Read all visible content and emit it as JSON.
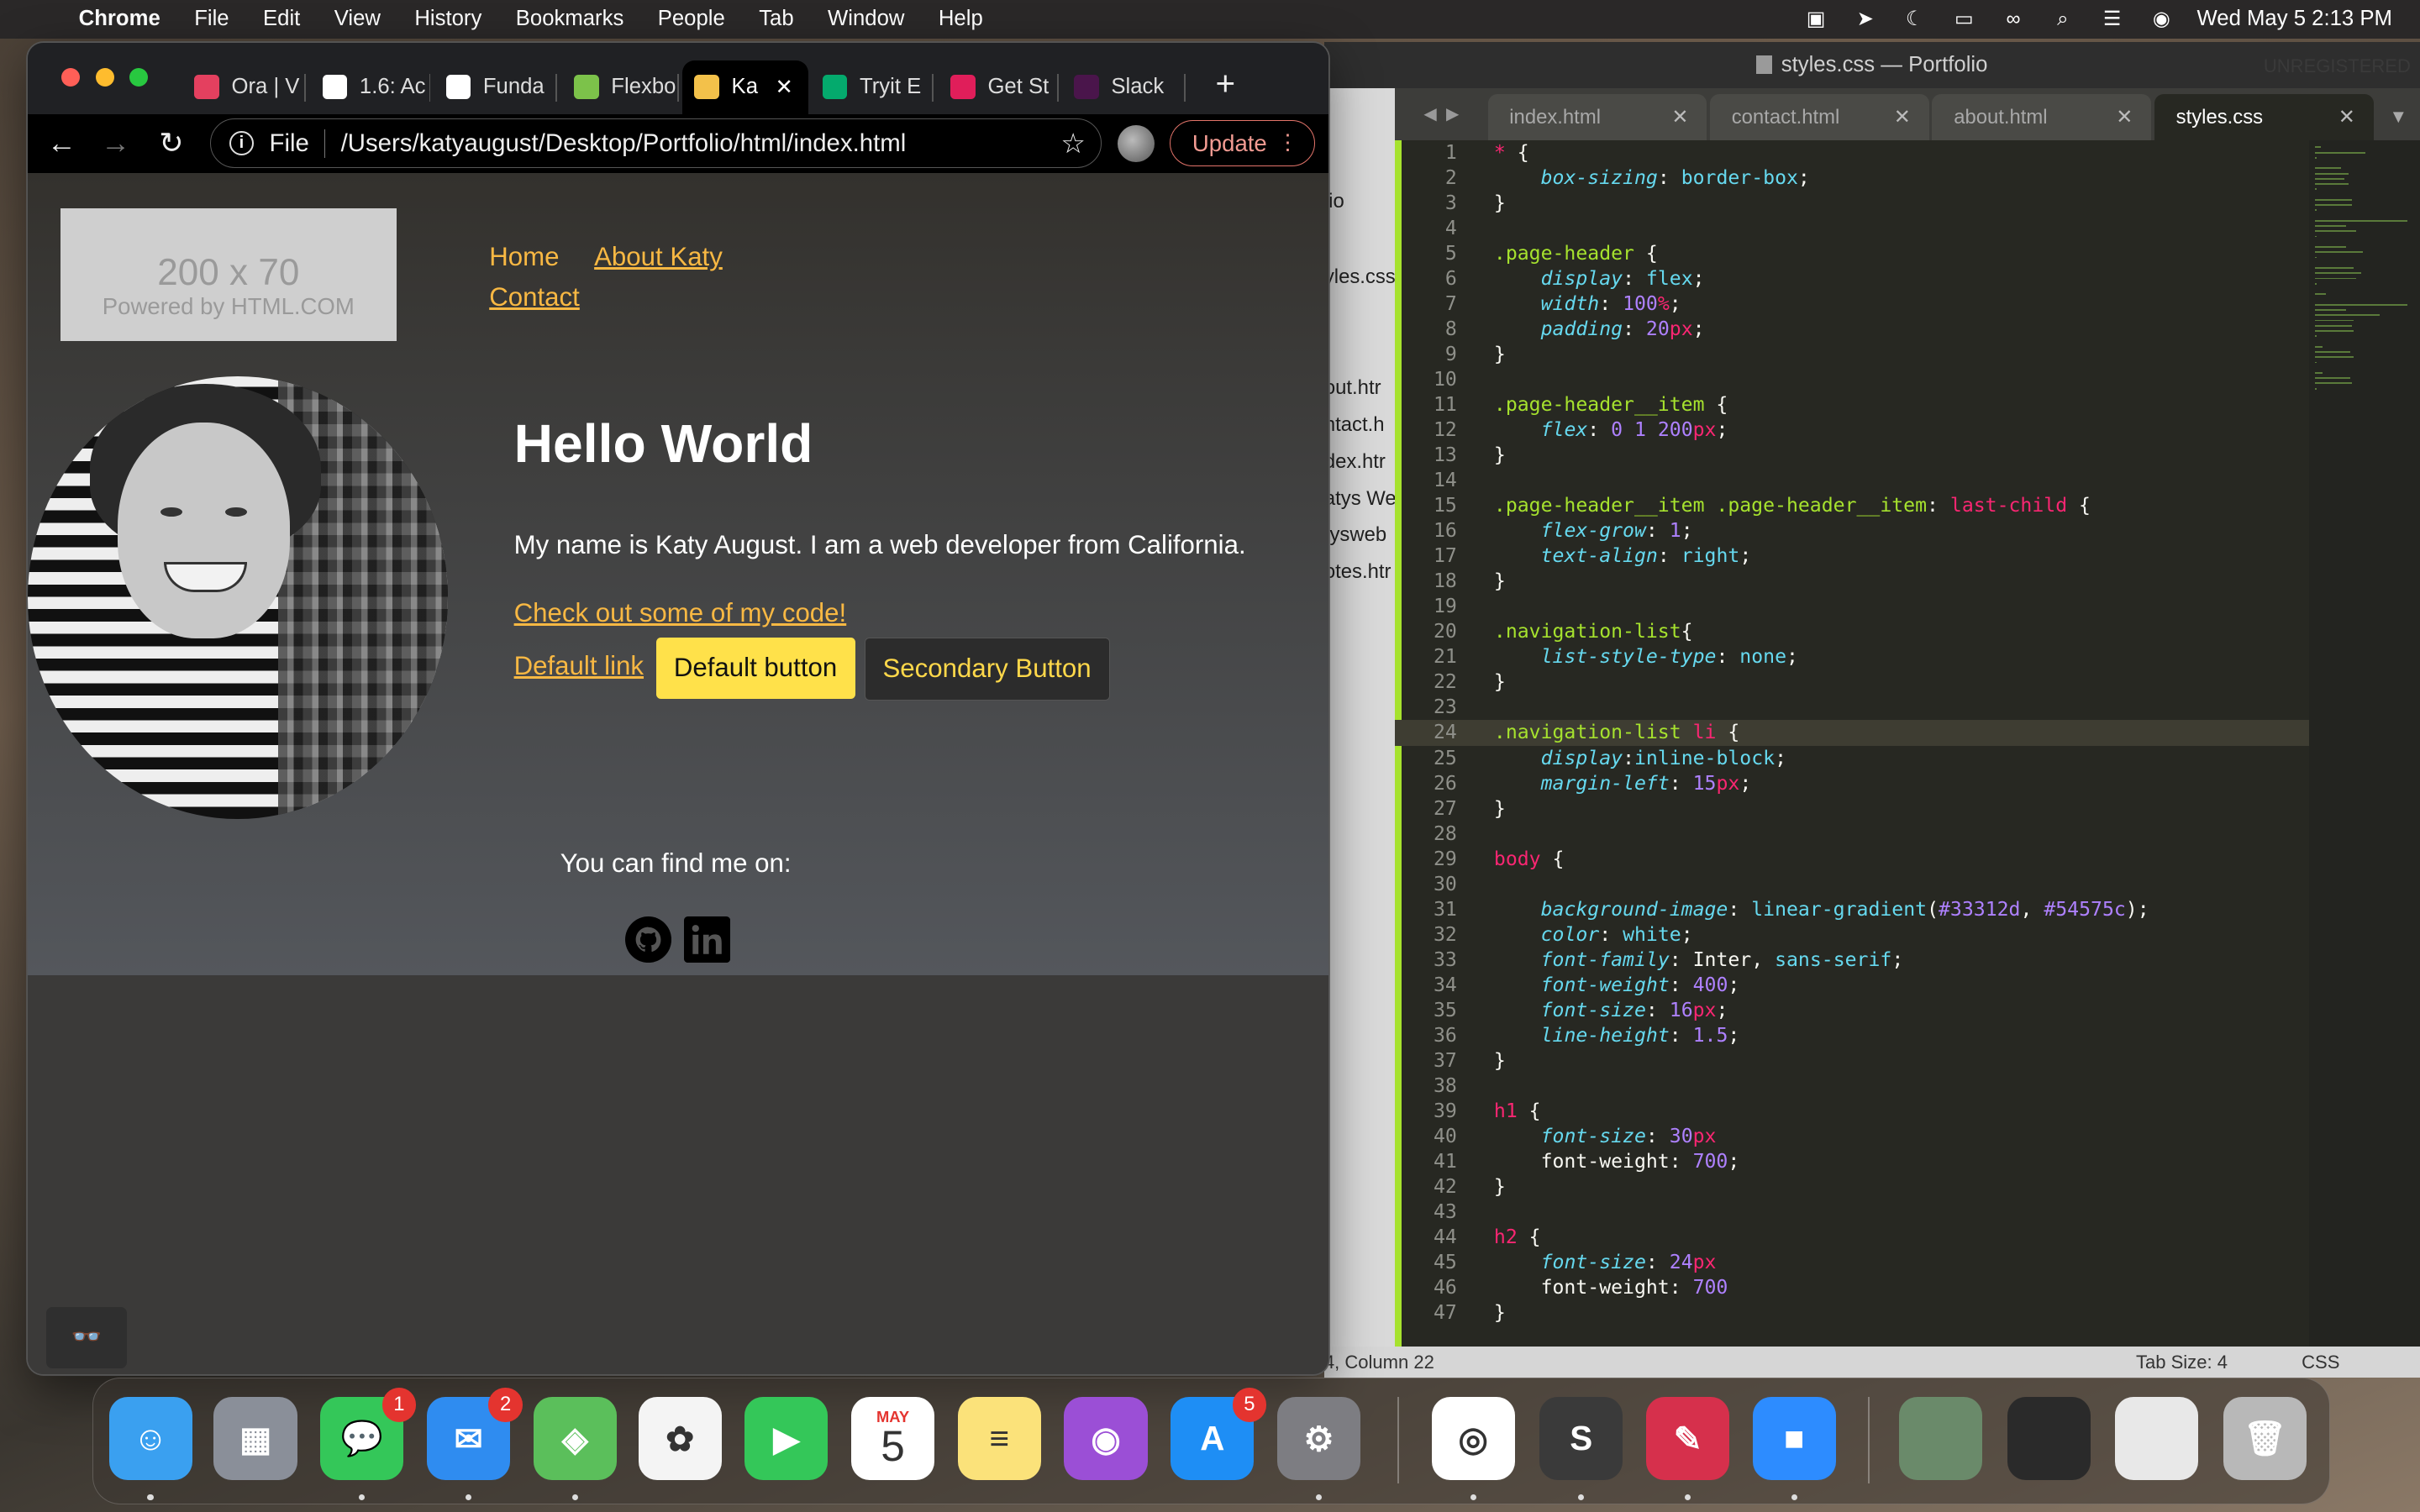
{
  "menubar": {
    "app_name": "Chrome",
    "items": [
      "File",
      "Edit",
      "View",
      "History",
      "Bookmarks",
      "People",
      "Tab",
      "Window",
      "Help"
    ],
    "status_icons": [
      "screen-record-icon",
      "share-arrow-icon",
      "do-not-disturb-moon-icon",
      "battery-icon",
      "link-icon",
      "spotlight-search-icon",
      "control-center-icon",
      "siri-icon"
    ],
    "clock": "Wed May 5  2:13 PM"
  },
  "chrome": {
    "tabs": [
      {
        "label": "Ora | V",
        "favicon": "ora-icon",
        "color": "#e4405f"
      },
      {
        "label": "1.6: Ac",
        "favicon": "of-icon",
        "color": "#ffffff"
      },
      {
        "label": "Funda",
        "favicon": "codepen-icon",
        "color": "#ffffff"
      },
      {
        "label": "Flexbo",
        "favicon": "frog-icon",
        "color": "#7cc24a"
      },
      {
        "label": "Ka",
        "favicon": "copy-icon",
        "color": "#f3c14a"
      },
      {
        "label": "Tryit E",
        "favicon": "w3schools-icon",
        "color": "#04aa6d"
      },
      {
        "label": "Get St",
        "favicon": "slack-icon",
        "color": "#e01e5a"
      },
      {
        "label": "Slack",
        "favicon": "slack-icon",
        "color": "#4a154b"
      }
    ],
    "active_tab_index": 4,
    "omnibox": {
      "scheme": "File",
      "url": "/Users/katyaugust/Desktop/Portfolio/html/index.html"
    },
    "update_label": "Update",
    "page": {
      "placeholder_big": "200 x 70",
      "placeholder_small": "Powered by HTML.COM",
      "nav": [
        "Home",
        "About Katy",
        "Contact"
      ],
      "heading": "Hello World",
      "intro": "My name is Katy August. I am a web developer from California.",
      "code_link": "Check out some of my code!",
      "default_link": "Default link",
      "default_button": "Default button",
      "secondary_button": "Secondary Button",
      "find_me": "You can find me on:",
      "social_icons": [
        "github-icon",
        "linkedin-icon"
      ]
    }
  },
  "sublime": {
    "title": "styles.css — Portfolio",
    "unregistered": "UNREGISTERED",
    "sidebar_items": [
      "lio",
      "yles.css",
      "out.htr",
      "ntact.h",
      "dex.htr",
      "atys We",
      "tysweb",
      "otes.htr"
    ],
    "tabs": [
      {
        "label": "index.html",
        "active": false
      },
      {
        "label": "contact.html",
        "active": false
      },
      {
        "label": "about.html",
        "active": false
      },
      {
        "label": "styles.css",
        "active": true
      }
    ],
    "current_line": 24,
    "status_position": "4, Column 22",
    "status_tab_size": "Tab Size: 4",
    "status_syntax": "CSS",
    "code_lines": [
      [
        [
          "t-tag",
          "*"
        ],
        [
          "t-plain",
          " {"
        ]
      ],
      [
        [
          "t-plain",
          "    "
        ],
        [
          "t-prop",
          "box-sizing"
        ],
        [
          "t-plain",
          ": "
        ],
        [
          "t-val",
          "border-box"
        ],
        [
          "t-plain",
          ";"
        ]
      ],
      [
        [
          "t-plain",
          "}"
        ]
      ],
      [],
      [
        [
          "t-sel",
          ".page-header"
        ],
        [
          "t-plain",
          " {"
        ]
      ],
      [
        [
          "t-plain",
          "    "
        ],
        [
          "t-prop",
          "display"
        ],
        [
          "t-plain",
          ": "
        ],
        [
          "t-val",
          "flex"
        ],
        [
          "t-plain",
          ";"
        ]
      ],
      [
        [
          "t-plain",
          "    "
        ],
        [
          "t-prop",
          "width"
        ],
        [
          "t-plain",
          ": "
        ],
        [
          "t-num",
          "100"
        ],
        [
          "t-unit",
          "%"
        ],
        [
          "t-plain",
          ";"
        ]
      ],
      [
        [
          "t-plain",
          "    "
        ],
        [
          "t-prop",
          "padding"
        ],
        [
          "t-plain",
          ": "
        ],
        [
          "t-num",
          "20"
        ],
        [
          "t-unit",
          "px"
        ],
        [
          "t-plain",
          ";"
        ]
      ],
      [
        [
          "t-plain",
          "}"
        ]
      ],
      [],
      [
        [
          "t-sel",
          ".page-header__item"
        ],
        [
          "t-plain",
          " {"
        ]
      ],
      [
        [
          "t-plain",
          "    "
        ],
        [
          "t-prop",
          "flex"
        ],
        [
          "t-plain",
          ": "
        ],
        [
          "t-num",
          "0 1 200"
        ],
        [
          "t-unit",
          "px"
        ],
        [
          "t-plain",
          ";"
        ]
      ],
      [
        [
          "t-plain",
          "}"
        ]
      ],
      [],
      [
        [
          "t-sel",
          ".page-header__item .page-header__item"
        ],
        [
          "t-plain",
          ": "
        ],
        [
          "t-tag",
          "last-child"
        ],
        [
          "t-plain",
          " {"
        ]
      ],
      [
        [
          "t-plain",
          "    "
        ],
        [
          "t-prop",
          "flex-grow"
        ],
        [
          "t-plain",
          ": "
        ],
        [
          "t-num",
          "1"
        ],
        [
          "t-plain",
          ";"
        ]
      ],
      [
        [
          "t-plain",
          "    "
        ],
        [
          "t-prop",
          "text-align"
        ],
        [
          "t-plain",
          ": "
        ],
        [
          "t-val",
          "right"
        ],
        [
          "t-plain",
          ";"
        ]
      ],
      [
        [
          "t-plain",
          "}"
        ]
      ],
      [],
      [
        [
          "t-sel",
          ".navigation-list"
        ],
        [
          "t-plain",
          "{"
        ]
      ],
      [
        [
          "t-plain",
          "    "
        ],
        [
          "t-prop",
          "list-style-type"
        ],
        [
          "t-plain",
          ": "
        ],
        [
          "t-val",
          "none"
        ],
        [
          "t-plain",
          ";"
        ]
      ],
      [
        [
          "t-plain",
          "}"
        ]
      ],
      [],
      [
        [
          "t-sel",
          ".navigation-list"
        ],
        [
          "t-plain",
          " "
        ],
        [
          "t-tag",
          "li"
        ],
        [
          "t-plain",
          " {"
        ]
      ],
      [
        [
          "t-plain",
          "    "
        ],
        [
          "t-prop",
          "display"
        ],
        [
          "t-plain",
          ":"
        ],
        [
          "t-val",
          "inline-block"
        ],
        [
          "t-plain",
          ";"
        ]
      ],
      [
        [
          "t-plain",
          "    "
        ],
        [
          "t-prop",
          "margin-left"
        ],
        [
          "t-plain",
          ": "
        ],
        [
          "t-num",
          "15"
        ],
        [
          "t-unit",
          "px"
        ],
        [
          "t-plain",
          ";"
        ]
      ],
      [
        [
          "t-plain",
          "}"
        ]
      ],
      [],
      [
        [
          "t-tag",
          "body"
        ],
        [
          "t-plain",
          " {"
        ]
      ],
      [],
      [
        [
          "t-plain",
          "    "
        ],
        [
          "t-prop",
          "background-image"
        ],
        [
          "t-plain",
          ": "
        ],
        [
          "t-val",
          "linear-gradient"
        ],
        [
          "t-plain",
          "("
        ],
        [
          "t-num",
          "#33312d"
        ],
        [
          "t-plain",
          ", "
        ],
        [
          "t-num",
          "#54575c"
        ],
        [
          "t-plain",
          ");"
        ]
      ],
      [
        [
          "t-plain",
          "    "
        ],
        [
          "t-prop",
          "color"
        ],
        [
          "t-plain",
          ": "
        ],
        [
          "t-val",
          "white"
        ],
        [
          "t-plain",
          ";"
        ]
      ],
      [
        [
          "t-plain",
          "    "
        ],
        [
          "t-prop",
          "font-family"
        ],
        [
          "t-plain",
          ": "
        ],
        [
          "t-plain",
          "Inter, "
        ],
        [
          "t-val",
          "sans-serif"
        ],
        [
          "t-plain",
          ";"
        ]
      ],
      [
        [
          "t-plain",
          "    "
        ],
        [
          "t-prop",
          "font-weight"
        ],
        [
          "t-plain",
          ": "
        ],
        [
          "t-num",
          "400"
        ],
        [
          "t-plain",
          ";"
        ]
      ],
      [
        [
          "t-plain",
          "    "
        ],
        [
          "t-prop",
          "font-size"
        ],
        [
          "t-plain",
          ": "
        ],
        [
          "t-num",
          "16"
        ],
        [
          "t-unit",
          "px"
        ],
        [
          "t-plain",
          ";"
        ]
      ],
      [
        [
          "t-plain",
          "    "
        ],
        [
          "t-prop",
          "line-height"
        ],
        [
          "t-plain",
          ": "
        ],
        [
          "t-num",
          "1.5"
        ],
        [
          "t-plain",
          ";"
        ]
      ],
      [
        [
          "t-plain",
          "}"
        ]
      ],
      [],
      [
        [
          "t-tag",
          "h1"
        ],
        [
          "t-plain",
          " {"
        ]
      ],
      [
        [
          "t-plain",
          "    "
        ],
        [
          "t-prop",
          "font-size"
        ],
        [
          "t-plain",
          ": "
        ],
        [
          "t-num",
          "30"
        ],
        [
          "t-unit",
          "px"
        ]
      ],
      [
        [
          "t-plain",
          "    font-weight: "
        ],
        [
          "t-num",
          "700"
        ],
        [
          "t-plain",
          ";"
        ]
      ],
      [
        [
          "t-plain",
          "}"
        ]
      ],
      [],
      [
        [
          "t-tag",
          "h2"
        ],
        [
          "t-plain",
          " {"
        ]
      ],
      [
        [
          "t-plain",
          "    "
        ],
        [
          "t-prop",
          "font-size"
        ],
        [
          "t-plain",
          ": "
        ],
        [
          "t-num",
          "24"
        ],
        [
          "t-unit",
          "px"
        ]
      ],
      [
        [
          "t-plain",
          "    font-weight: "
        ],
        [
          "t-num",
          "700"
        ]
      ],
      [
        [
          "t-plain",
          "}"
        ]
      ]
    ]
  },
  "dock": {
    "apps": [
      {
        "name": "finder-icon",
        "color": "#3aa0f0",
        "glyph": "☺",
        "running": true
      },
      {
        "name": "launchpad-icon",
        "color": "#8a8f99",
        "glyph": "▦",
        "running": false
      },
      {
        "name": "messages-icon",
        "color": "#34c759",
        "glyph": "💬",
        "running": true,
        "badge": "1"
      },
      {
        "name": "mail-icon",
        "color": "#2f8cf0",
        "glyph": "✉",
        "running": true,
        "badge": "2"
      },
      {
        "name": "maps-icon",
        "color": "#5bbf5b",
        "glyph": "◈",
        "running": true
      },
      {
        "name": "photos-icon",
        "color": "#f4f4f4",
        "glyph": "✿",
        "running": false
      },
      {
        "name": "facetime-icon",
        "color": "#34c759",
        "glyph": "▶",
        "running": false
      },
      {
        "name": "calendar-icon",
        "color": "#ffffff",
        "glyph": "5",
        "running": false,
        "month": "MAY"
      },
      {
        "name": "notes-icon",
        "color": "#fbe27a",
        "glyph": "≡",
        "running": false
      },
      {
        "name": "podcasts-icon",
        "color": "#9b4fd6",
        "glyph": "◉",
        "running": false
      },
      {
        "name": "app-store-icon",
        "color": "#1e8ef5",
        "glyph": "A",
        "running": false,
        "badge": "5"
      },
      {
        "name": "system-preferences-icon",
        "color": "#7d7d82",
        "glyph": "⚙",
        "running": true
      },
      {
        "name": "chrome-icon",
        "color": "#ffffff",
        "glyph": "◎",
        "running": true
      },
      {
        "name": "sublime-text-icon",
        "color": "#3a3a3a",
        "glyph": "S",
        "running": true
      },
      {
        "name": "skitch-icon",
        "color": "#d6304c",
        "glyph": "✎",
        "running": true
      },
      {
        "name": "zoom-icon",
        "color": "#2d8cff",
        "glyph": "■",
        "running": true
      },
      {
        "name": "recent-photo-thumbnail-icon",
        "color": "#6a8a6a",
        "glyph": "",
        "running": false
      },
      {
        "name": "recent-screenshot-thumbnail-icon",
        "color": "#2a2a2a",
        "glyph": "",
        "running": false
      },
      {
        "name": "recent-document-thumbnail-icon",
        "color": "#e8e8e8",
        "glyph": "",
        "running": false
      },
      {
        "name": "trash-icon",
        "color": "#b8b8b8",
        "glyph": "🗑",
        "running": false
      }
    ]
  }
}
